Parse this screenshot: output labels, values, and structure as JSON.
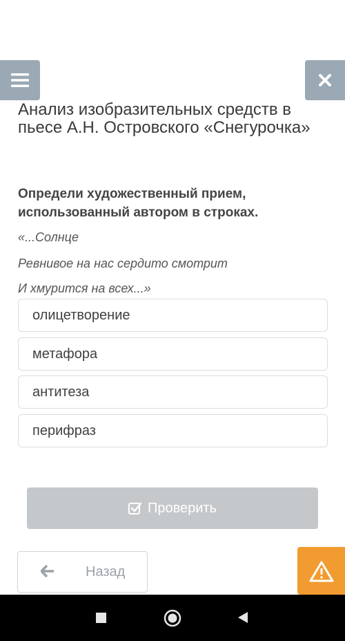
{
  "header": {
    "menu_icon": "hamburger-menu-icon",
    "close_icon": "close-x-icon",
    "button_color": "#9aa9b4"
  },
  "title": "Анализ изобразительных средств в пьесе А.Н. Островского «Снегурочка»",
  "question": "Определи художественный прием, использованный автором в строках.",
  "quote": [
    "«...Солнце",
    "Ревнивое на нас сердито смотрит",
    "И хмурится на всех...»"
  ],
  "options": [
    "олицетворение",
    "метафора",
    "антитеза",
    "перифраз"
  ],
  "check_button": {
    "label": "Проверить",
    "icon": "check-square-icon"
  },
  "back_button": {
    "label": "Назад",
    "icon": "arrow-left-icon"
  },
  "warning_button": {
    "icon": "warning-triangle-icon",
    "color": "#f29b30"
  }
}
